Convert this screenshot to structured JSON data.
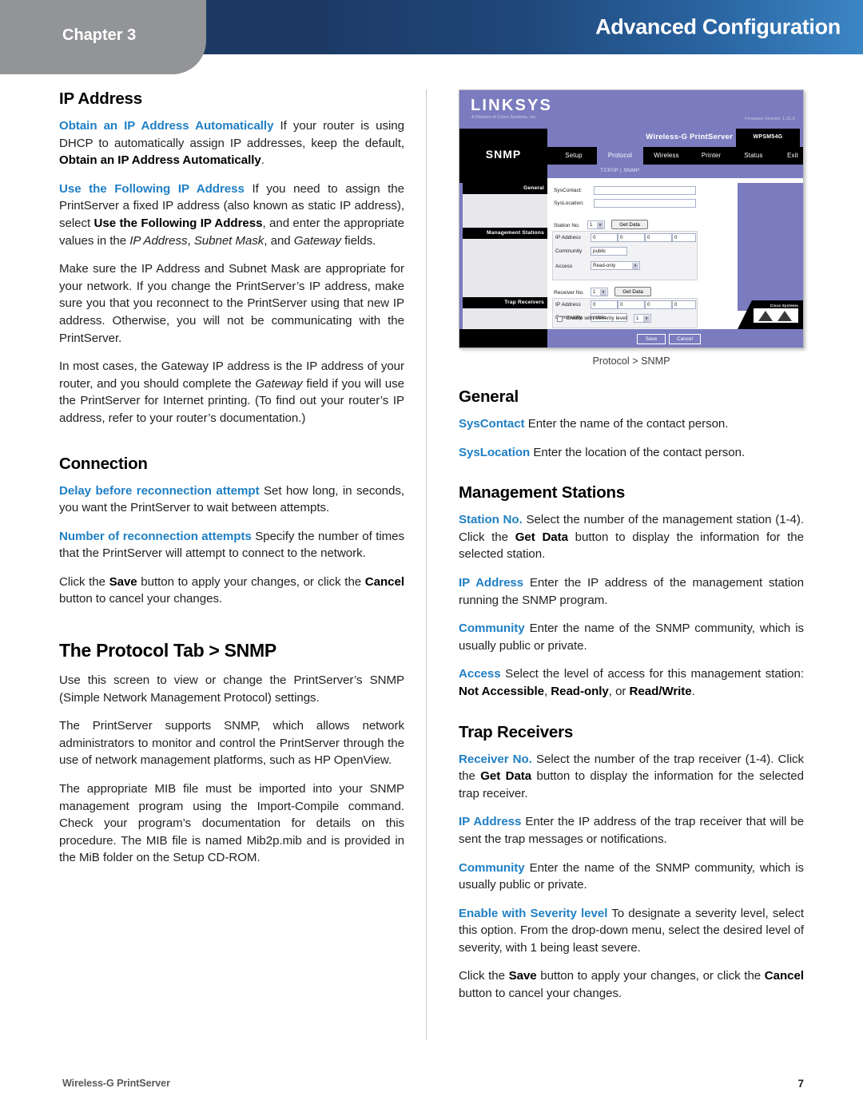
{
  "header": {
    "chapter_label": "Chapter 3",
    "title": "Advanced Configuration"
  },
  "left_column": {
    "heading_ip_address": "IP Address",
    "p1_lead": "Obtain an IP Address Automatically",
    "p1_a": " If your router is using DHCP to automatically assign IP addresses, keep the default, ",
    "p1_b": "Obtain an IP Address Automatically",
    "p1_c": ".",
    "p2_lead": "Use the Following IP Address",
    "p2_a": " If you need to assign the PrintServer a fixed IP address (also known as static IP address), select ",
    "p2_b": "Use the Following IP Address",
    "p2_c": ", and enter the appropriate values in the ",
    "p2_d": "IP Address",
    "p2_e": ", ",
    "p2_f": "Subnet Mask",
    "p2_g": ", and ",
    "p2_h": "Gateway",
    "p2_i": " fields.",
    "p3": "Make sure the IP Address and Subnet Mask are appropriate for your network. If you change the PrintServer’s IP address, make sure you that you reconnect to the PrintServer using that new IP address. Otherwise, you will not be communicating with the PrintServer.",
    "p4_a": "In most cases, the Gateway IP address is the IP address of your router, and you should complete the ",
    "p4_b": "Gateway",
    "p4_c": " field if you will use the PrintServer for Internet printing. (To find out your router’s IP address, refer to your router’s documentation.)",
    "heading_connection": "Connection",
    "p5_lead": "Delay before reconnection attempt",
    "p5_a": " Set how long, in seconds, you want the PrintServer to wait between attempts.",
    "p6_lead": "Number of reconnection attempts",
    "p6_a": "  Specify the number of times that the PrintServer will attempt to connect to the network.",
    "p7_a": "Click the ",
    "p7_b": "Save",
    "p7_c": " button to apply your changes, or click the ",
    "p7_d": "Cancel",
    "p7_e": " button to cancel your changes.",
    "heading_protocol_tab": "The Protocol Tab > SNMP",
    "p8": "Use this screen to view or change the PrintServer’s SNMP (Simple Network Management Protocol) settings.",
    "p9": "The PrintServer supports SNMP, which allows network administrators to monitor and control the PrintServer through the use of network management platforms, such as HP OpenView.",
    "p10": "The appropriate MIB file must be imported into your SNMP management program using the Import-Compile command. Check your program’s documentation for details on this procedure. The MIB file is named Mib2p.mib and is provided in the MiB folder on the Setup CD-ROM."
  },
  "figure": {
    "caption": "Protocol > SNMP",
    "ui": {
      "brand": "LINKSYS",
      "brand_tagline": "A Division of Cisco Systems, Inc.",
      "firmware_version": "Firmware Version:  1.01.6",
      "page_title": "SNMP",
      "product_name": "Wireless-G PrintServer",
      "model": "WPSM54G",
      "nav_tabs": [
        {
          "label": "Setup",
          "active": false
        },
        {
          "label": "Protocol",
          "active": true
        },
        {
          "label": "Wireless",
          "active": false
        },
        {
          "label": "Printer",
          "active": false
        },
        {
          "label": "Status",
          "active": false
        },
        {
          "label": "Exit",
          "active": false
        }
      ],
      "subnav": "TCP/IP  |  SNMP",
      "sidebar_sections": [
        "General",
        "Management Stations",
        "Trap Receivers"
      ],
      "general": {
        "syscontact_label": "SysContact:",
        "syscontact_value": "",
        "syslocation_label": "SysLocation:",
        "syslocation_value": ""
      },
      "management_stations": {
        "station_no_label": "Station No.",
        "station_no_value": "1",
        "get_data_button": "Get Data",
        "ip_label": "IP Address",
        "ip_octets": [
          "0",
          "0",
          "0",
          "0"
        ],
        "community_label": "Community",
        "community_value": "public",
        "access_label": "Access",
        "access_value": "Read-only"
      },
      "trap_receivers": {
        "receiver_no_label": "Receiver No.",
        "receiver_no_value": "1",
        "get_data_button": "Get Data",
        "ip_label": "IP Address",
        "ip_octets": [
          "0",
          "0",
          "0",
          "0"
        ],
        "community_label": "Community",
        "community_value": "public",
        "severity_label": "Enable with Severity level:",
        "severity_value": "1"
      },
      "save_button": "Save",
      "cancel_button": "Cancel",
      "cisco_label": "Cisco Systems"
    }
  },
  "right_column": {
    "heading_general": "General",
    "g1_lead": "SysContact",
    "g1_a": "  Enter the name of the contact person.",
    "g2_lead": "SysLocation",
    "g2_a": "  Enter the location of the contact person.",
    "heading_management_stations": "Management Stations",
    "m1_lead": "Station No.",
    "m1_a": " Select the number of the management station (1-4). Click the ",
    "m1_b": "Get Data",
    "m1_c": " button to display the information for the selected station.",
    "m2_lead": "IP Address",
    "m2_a": " Enter the IP address of the management station running the SNMP program.",
    "m3_lead": "Community",
    "m3_a": " Enter the name of the SNMP community, which is usually public or private.",
    "m4_lead": "Access",
    "m4_a": " Select the level of access for this management station: ",
    "m4_b": "Not Accessible",
    "m4_c": ", ",
    "m4_d": "Read-only",
    "m4_e": ", or ",
    "m4_f": "Read/Write",
    "m4_g": ".",
    "heading_trap_receivers": "Trap Receivers",
    "t1_lead": "Receiver No.",
    "t1_a": "  Select the number of the trap receiver (1-4). Click the ",
    "t1_b": "Get Data",
    "t1_c": " button to display the information for the selected trap receiver.",
    "t2_lead": "IP Address",
    "t2_a": "  Enter the IP address of the trap receiver that will be sent the trap messages or notifications.",
    "t3_lead": "Community",
    "t3_a": " Enter the name of the SNMP community, which is usually public or private.",
    "t4_lead": "Enable with Severity level",
    "t4_a": "  To designate a severity level, select this option. From the drop-down menu, select the desired level of severity, with 1 being least severe.",
    "t5_a": "Click the ",
    "t5_b": "Save",
    "t5_c": " button to apply your changes, or click the ",
    "t5_d": "Cancel",
    "t5_e": " button to cancel your changes."
  },
  "footer": {
    "left": "Wireless-G PrintServer",
    "page_number": "7"
  }
}
